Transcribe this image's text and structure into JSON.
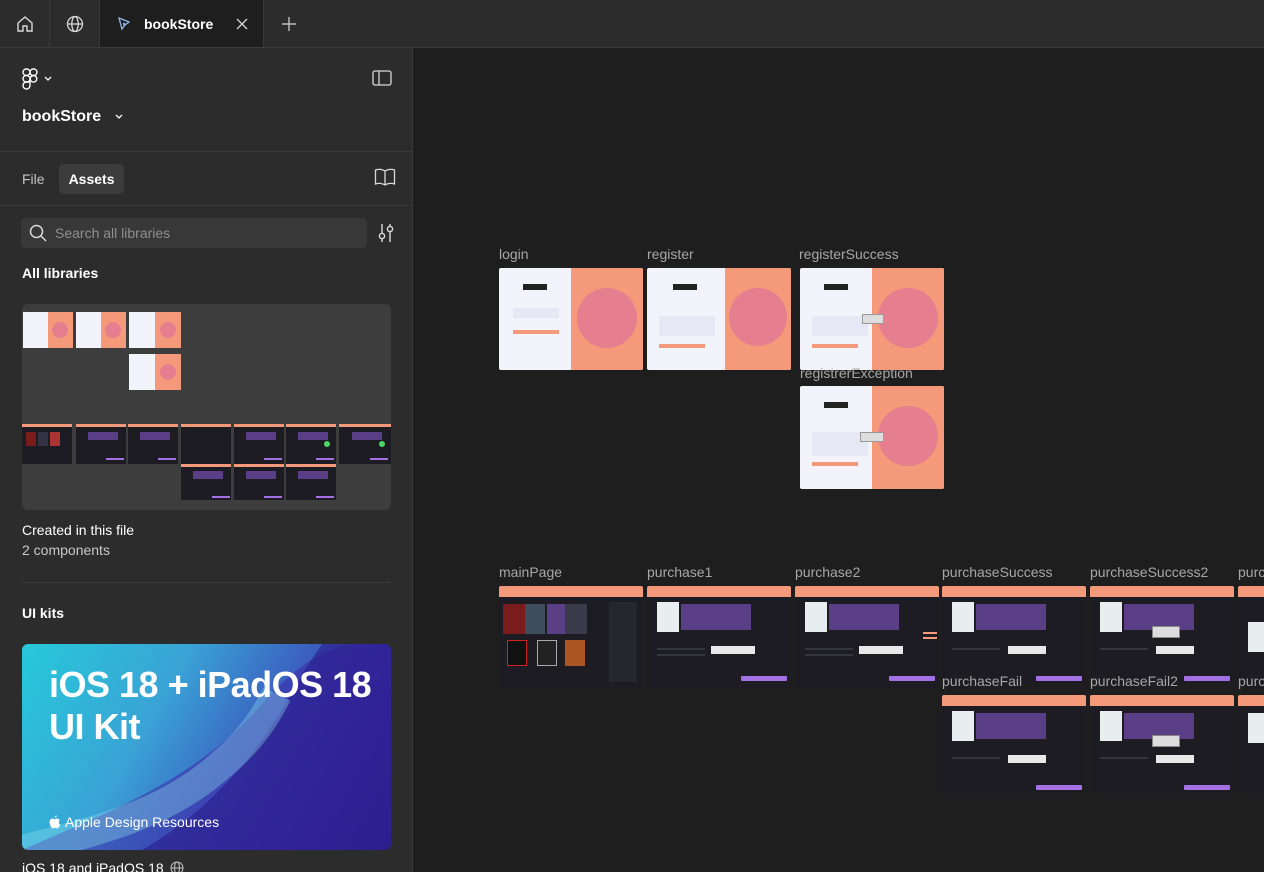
{
  "tabbar": {
    "file_tab_title": "bookStore"
  },
  "sidebar": {
    "file_name": "bookStore",
    "tabs": [
      "File",
      "Assets"
    ],
    "active_tab": "Assets",
    "search_placeholder": "Search all libraries",
    "all_libraries_title": "All libraries",
    "local_library": {
      "name": "Created in this file",
      "count": "2 components"
    },
    "ui_kits_title": "UI kits",
    "kit": {
      "title_line1": "iOS 18 + iPadOS 18",
      "title_line2": "UI Kit",
      "brand": "Apple Design Resources",
      "name": "iOS 18 and iPadOS 18"
    }
  },
  "canvas": {
    "frames": {
      "login": "login",
      "register": "register",
      "registerSuccess": "registerSuccess",
      "registerException": "registrerException",
      "mainPage": "mainPage",
      "purchase1": "purchase1",
      "purchase2": "purchase2",
      "purchaseSuccess": "purchaseSuccess",
      "purchaseSuccess2": "purchaseSuccess2",
      "purchaseFail": "purchaseFail",
      "purchaseFail2": "purchaseFail2",
      "cutoff1": "purc",
      "cutoff2": "purc"
    }
  }
}
